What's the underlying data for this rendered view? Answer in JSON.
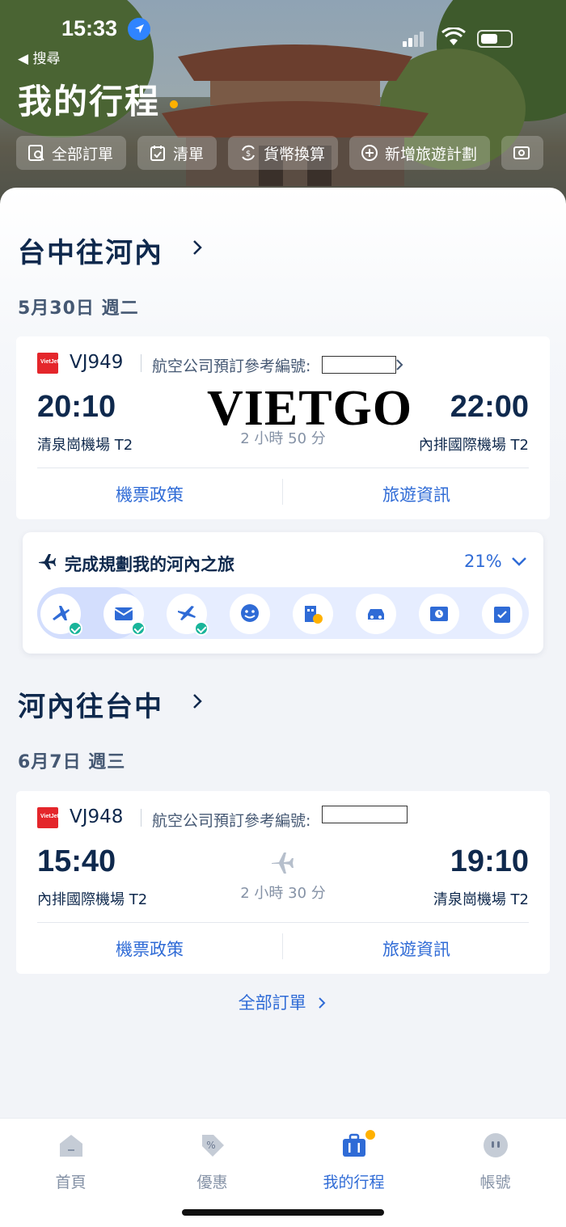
{
  "status_bar": {
    "time": "15:33",
    "back_label": "◀ 搜尋"
  },
  "header": {
    "title": "我的行程"
  },
  "quick_actions": [
    {
      "label": "全部訂單",
      "icon": "orders-search-icon"
    },
    {
      "label": "清單",
      "icon": "checklist-icon"
    },
    {
      "label": "貨幣換算",
      "icon": "currency-exchange-icon"
    },
    {
      "label": "新增旅遊計劃",
      "icon": "add-circle-icon"
    },
    {
      "label": "",
      "icon": "clock-card-icon"
    }
  ],
  "trips": [
    {
      "route": "台中往河內",
      "date": "5月30日 週二",
      "flight_no": "VJ949",
      "ref_label": "航空公司預訂參考編號:",
      "dep_time": "20:10",
      "dep_airport": "清泉崗機場 T2",
      "duration": "2 小時 50 分",
      "arr_time": "22:00",
      "arr_airport": "內排國際機場 T2",
      "link_policy": "機票政策",
      "link_info": "旅遊資訊"
    },
    {
      "route": "河內往台中",
      "date": "6月7日 週三",
      "flight_no": "VJ948",
      "ref_label": "航空公司預訂參考編號:",
      "dep_time": "15:40",
      "dep_airport": "內排國際機場 T2",
      "duration": "2 小時 30 分",
      "arr_time": "19:10",
      "arr_airport": "清泉崗機場 T2",
      "link_policy": "機票政策",
      "link_info": "旅遊資訊"
    }
  ],
  "planning": {
    "title": "完成規劃我的河內之旅",
    "percent": "21%",
    "progress": 0.21,
    "steps": [
      {
        "icon": "flight-icon",
        "done": true
      },
      {
        "icon": "mail-icon",
        "done": true
      },
      {
        "icon": "flight-depart-icon",
        "done": true
      },
      {
        "icon": "face-icon",
        "done": false
      },
      {
        "icon": "hotel-icon",
        "done": false
      },
      {
        "icon": "car-icon",
        "done": false
      },
      {
        "icon": "ticket-clock-icon",
        "done": false
      },
      {
        "icon": "calendar-check-icon",
        "done": false
      }
    ]
  },
  "all_orders_link": "全部訂單",
  "watermark": "VIETGO",
  "tabs": [
    {
      "label": "首頁",
      "icon": "home-icon",
      "active": false
    },
    {
      "label": "優惠",
      "icon": "discount-tag-icon",
      "active": false
    },
    {
      "label": "我的行程",
      "icon": "trips-briefcase-icon",
      "active": true
    },
    {
      "label": "帳號",
      "icon": "account-icon",
      "active": false
    }
  ],
  "colors": {
    "accent": "#2f6bd6",
    "navy": "#0f294d",
    "orange": "#ffb100",
    "airline_red": "#e4262b",
    "check_green": "#19b49a"
  }
}
